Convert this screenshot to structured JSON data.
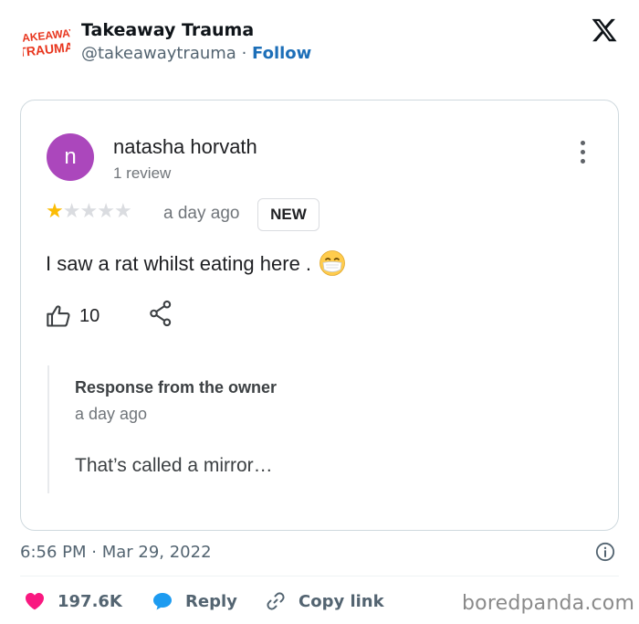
{
  "author": {
    "name": "Takeaway Trauma",
    "handle": "@takeawaytrauma",
    "separator": " · ",
    "follow_label": "Follow",
    "logo_text_top": "TAKEAWAY",
    "logo_text_bottom": "TRAUMA"
  },
  "review": {
    "avatar_letter": "n",
    "reviewer_name": "natasha horvath",
    "review_count": "1 review",
    "rating": 1,
    "rating_max": 5,
    "time": "a day ago",
    "badge": "NEW",
    "text": "I saw a rat whilst eating here .",
    "emoji": "face-with-medical-mask",
    "likes": "10",
    "owner_response": {
      "title": "Response from the owner",
      "time": "a day ago",
      "text": "That’s called a mirror…"
    }
  },
  "footer": {
    "timestamp": "6:56 PM · Mar 29, 2022",
    "like_count": "197.6K",
    "reply_label": "Reply",
    "copy_link_label": "Copy link"
  },
  "watermark": "boredpanda.com",
  "colors": {
    "avatar": "#ab47bc",
    "star": "#fbbc04",
    "heart": "#f91880",
    "reply_bubble": "#1d9bf0",
    "follow": "#1d6fb8",
    "logo": "#e8361e"
  }
}
